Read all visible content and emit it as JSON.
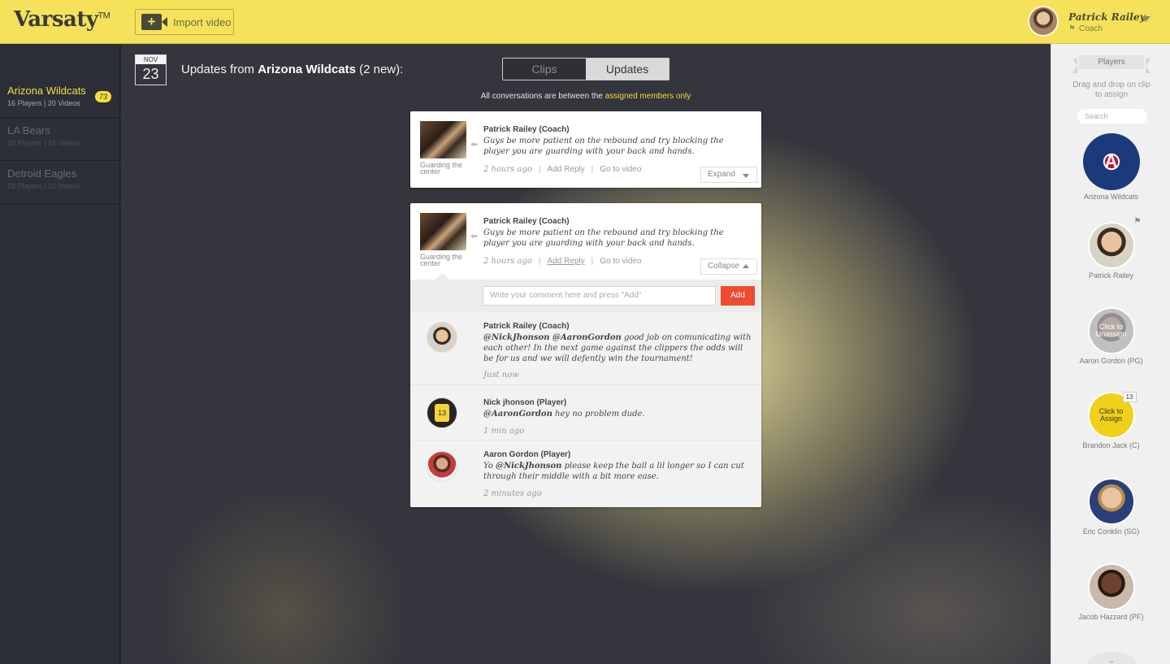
{
  "header": {
    "logo": "Varsaty",
    "logo_tm": "TM",
    "import_label": "Import video",
    "user_name": "Patrick Railey",
    "user_role": "Coach"
  },
  "sidebar": {
    "teams": [
      {
        "name": "Arizona Wildcats",
        "meta": "16 Players  |  20 Videos",
        "badge": "73"
      },
      {
        "name": "LA Bears",
        "meta": "20 Players  |  15 Videos"
      },
      {
        "name": "Detroid Eagles",
        "meta": "28 Players  |  10 Videos"
      }
    ]
  },
  "main": {
    "date_month": "NOV",
    "date_day": "23",
    "title_prefix": "Updates from ",
    "title_team": "Arizona Wildcats",
    "title_suffix": " (2 new):",
    "tabs": {
      "clips": "Clips",
      "updates": "Updates"
    },
    "notice_prefix": "All conversations are between the ",
    "notice_link": "assigned members only",
    "cards": [
      {
        "thumb_caption": "Guarding the center",
        "author": "Patrick Railey (Coach)",
        "text": "Guys be more patient on the rebound and try blocking the player you are guarding with your back and hands.",
        "ago": "2 hours ago",
        "add_reply": "Add Reply",
        "go_to_video": "Go to video",
        "toggle": "Expand"
      },
      {
        "thumb_caption": "Guarding the center",
        "author": "Patrick Railey (Coach)",
        "text": "Guys be more patient on the rebound and try blocking the player you are guarding with your back and hands.",
        "ago": "2 hours ago",
        "add_reply": "Add Reply",
        "go_to_video": "Go to video",
        "toggle": "Collapse",
        "comment_placeholder": "Write your comment here and press \"Add\"",
        "add_label": "Add",
        "replies": [
          {
            "author": "Patrick Railey (Coach)",
            "mentions": "@NickJhonson @AaronGordon",
            "text": " good job on comunicating with each other! In the next game against the clippers the odds will be for us and we will defently win the tournament!",
            "time": "Just now"
          },
          {
            "author": "Nick jhonson (Player)",
            "mentions": "@AaronGordon",
            "text": " hey no problem dude.",
            "time": "1 min ago",
            "jersey": "13"
          },
          {
            "author": "Aaron Gordon (Player)",
            "mentions_prefix": "Yo ",
            "mentions": "@NickJhonson",
            "text": " please keep the ball a lil longer so I can cut through their middle with a bit more ease.",
            "time": "2 minutes ago"
          }
        ]
      }
    ]
  },
  "rpanel": {
    "ribbon": "Players",
    "hint": "Drag and drop on clip to assign",
    "search_placeholder": "Search",
    "players": [
      {
        "name": "Arizona Wildcats"
      },
      {
        "name": "Patrick Railey"
      },
      {
        "name": "Aaron Gordon (PG)",
        "overlay": "Click to Unassign"
      },
      {
        "name": "Brandon Jack (C)",
        "overlay": "Click to Assign",
        "jersey": "13"
      },
      {
        "name": "Eric Conklin (SG)"
      },
      {
        "name": "Jacob Hazzard (PF)"
      }
    ]
  },
  "colors": {
    "accent": "#f5e25a",
    "add_button": "#ee4b2f",
    "link": "#f3da3a"
  }
}
